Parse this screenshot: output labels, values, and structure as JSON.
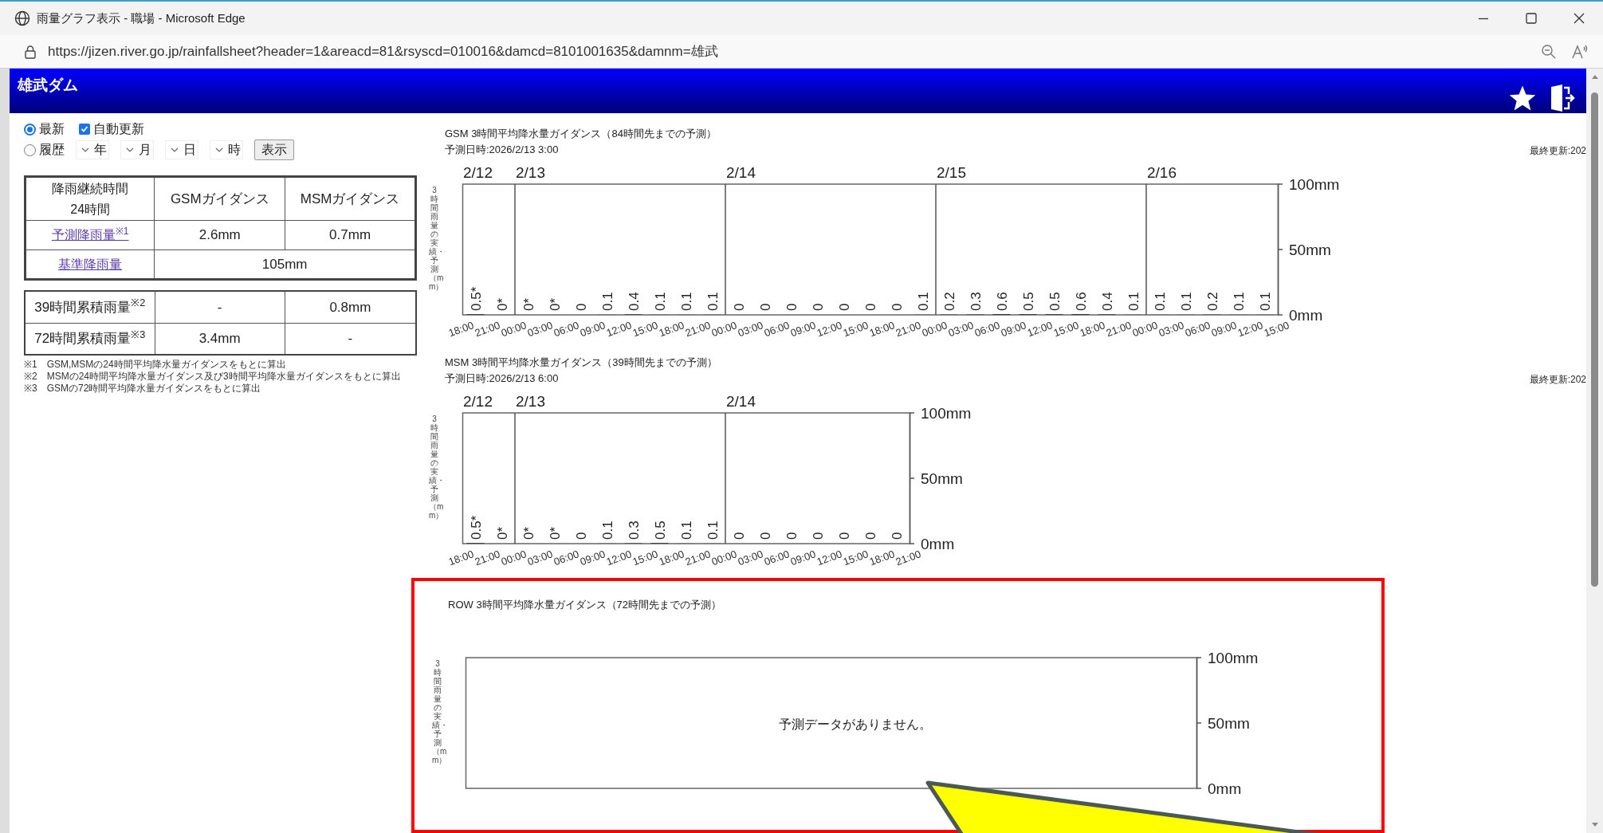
{
  "window": {
    "title": "雨量グラフ表示 - 職場 - Microsoft Edge"
  },
  "address_bar": {
    "url": "https://jizen.river.go.jp/rainfallsheet?header=1&areacd=81&rsyscd=010016&damcd=8101001635&damnm=雄武"
  },
  "header": {
    "title": "雄武ダム"
  },
  "mode_options": [
    {
      "label": "最新",
      "selected": true
    },
    {
      "label": "履歴",
      "selected": false
    }
  ],
  "auto_update": {
    "label": "自動更新",
    "checked": true
  },
  "date_selects": [
    "年",
    "月",
    "日",
    "時"
  ],
  "show_button": "表示",
  "rainfall_table": {
    "header": [
      "降雨継続時間\n24時間",
      "GSMガイダンス",
      "MSMガイダンス"
    ],
    "rows": [
      {
        "label": "予測降雨量$^{※1}$",
        "link": true,
        "cells": [
          "2.6mm",
          "0.7mm"
        ]
      },
      {
        "label": "基準降雨量",
        "link": true,
        "cells": [
          {
            "text": "105mm",
            "colspan": 2
          }
        ]
      }
    ]
  },
  "accumulated_table": {
    "rows": [
      {
        "label": "39時間累積雨量$^{※2}$",
        "link": false,
        "cells": [
          "-",
          "0.8mm"
        ]
      },
      {
        "label": "72時間累積雨量$^{※3}$",
        "link": false,
        "cells": [
          "3.4mm",
          "-"
        ]
      }
    ]
  },
  "notes": [
    "※1　GSM,MSMの24時間平均降水量ガイダンスをもとに算出",
    "※2　MSMの24時間平均降水量ガイダンス及び3時間平均降水量ガイダンスをもとに算出",
    "※3　GSMの72時間平均降水量ガイダンスをもとに算出"
  ],
  "charts": [
    {
      "title": "GSM 3時間平均降水量ガイダンス（84時間先までの予測）",
      "forecast_time": "予測日時:2026/2/13 3:00",
      "last_updated": "最終更新:202",
      "highlighted": false,
      "chart_data": {
        "type": "bar",
        "ylabel": "3時間雨量の実績・予測（mm）",
        "ylim": [
          0,
          100
        ],
        "xlim": [
          "2026-02-12T18:00",
          "2026-02-16T15:00"
        ],
        "grid": true,
        "yticks": [
          {
            "value": 0,
            "label": "0mm"
          },
          {
            "value": 50,
            "label": "50mm"
          },
          {
            "value": 100,
            "label": "100mm"
          }
        ],
        "x": [
          "2026-02-12T19:30",
          "2026-02-12T22:30",
          "2026-02-13T01:30",
          "2026-02-13T04:30",
          "2026-02-13T07:30",
          "2026-02-13T10:30",
          "2026-02-13T13:30",
          "2026-02-13T16:30",
          "2026-02-13T19:30",
          "2026-02-13T22:30",
          "2026-02-14T01:30",
          "2026-02-14T04:30",
          "2026-02-14T07:30",
          "2026-02-14T10:30",
          "2026-02-14T13:30",
          "2026-02-14T16:30",
          "2026-02-14T19:30",
          "2026-02-14T22:30",
          "2026-02-15T01:30",
          "2026-02-15T04:30",
          "2026-02-15T07:30",
          "2026-02-15T10:30",
          "2026-02-15T13:30",
          "2026-02-15T16:30",
          "2026-02-15T19:30",
          "2026-02-15T22:30",
          "2026-02-16T01:30",
          "2026-02-16T04:30",
          "2026-02-16T07:30",
          "2026-02-16T10:30",
          "2026-02-16T13:30"
        ],
        "values": [
          0.5,
          0,
          0,
          0,
          0,
          0.1,
          0.4,
          0.1,
          0.1,
          0.1,
          0,
          0,
          0,
          0,
          0,
          0,
          0,
          0.1,
          0.2,
          0.3,
          0.6,
          0.5,
          0.5,
          0.6,
          0.4,
          0.1,
          0.1,
          0.1,
          0.2,
          0.1,
          0.1
        ],
        "value_labels": [
          "0.5*",
          "0*",
          "0*",
          "0*",
          "0",
          "0.1",
          "0.4",
          "0.1",
          "0.1",
          "0.1",
          "0",
          "0",
          "0",
          "0",
          "0",
          "0",
          "0",
          "0.1",
          "0.2",
          "0.3",
          "0.6",
          "0.5",
          "0.5",
          "0.6",
          "0.4",
          "0.1",
          "0.1",
          "0.1",
          "0.2",
          "0.1",
          "0.1"
        ],
        "xticks": [
          {
            "value": "2026-02-12T18:00",
            "label": "18:00"
          },
          {
            "value": "2026-02-12T21:00",
            "label": "21:00"
          },
          {
            "value": "2026-02-13T00:00",
            "label": "00:00"
          },
          {
            "value": "2026-02-13T03:00",
            "label": "03:00"
          },
          {
            "value": "2026-02-13T06:00",
            "label": "06:00"
          },
          {
            "value": "2026-02-13T09:00",
            "label": "09:00"
          },
          {
            "value": "2026-02-13T12:00",
            "label": "12:00"
          },
          {
            "value": "2026-02-13T15:00",
            "label": "15:00"
          },
          {
            "value": "2026-02-13T18:00",
            "label": "18:00"
          },
          {
            "value": "2026-02-13T21:00",
            "label": "21:00"
          },
          {
            "value": "2026-02-14T00:00",
            "label": "00:00"
          },
          {
            "value": "2026-02-14T03:00",
            "label": "03:00"
          },
          {
            "value": "2026-02-14T06:00",
            "label": "06:00"
          },
          {
            "value": "2026-02-14T09:00",
            "label": "09:00"
          },
          {
            "value": "2026-02-14T12:00",
            "label": "12:00"
          },
          {
            "value": "2026-02-14T15:00",
            "label": "15:00"
          },
          {
            "value": "2026-02-14T18:00",
            "label": "18:00"
          },
          {
            "value": "2026-02-14T21:00",
            "label": "21:00"
          },
          {
            "value": "2026-02-15T00:00",
            "label": "00:00"
          },
          {
            "value": "2026-02-15T03:00",
            "label": "03:00"
          },
          {
            "value": "2026-02-15T06:00",
            "label": "06:00"
          },
          {
            "value": "2026-02-15T09:00",
            "label": "09:00"
          },
          {
            "value": "2026-02-15T12:00",
            "label": "12:00"
          },
          {
            "value": "2026-02-15T15:00",
            "label": "15:00"
          },
          {
            "value": "2026-02-15T18:00",
            "label": "18:00"
          },
          {
            "value": "2026-02-15T21:00",
            "label": "21:00"
          },
          {
            "value": "2026-02-16T00:00",
            "label": "00:00"
          },
          {
            "value": "2026-02-16T03:00",
            "label": "03:00"
          },
          {
            "value": "2026-02-16T06:00",
            "label": "06:00"
          },
          {
            "value": "2026-02-16T09:00",
            "label": "09:00"
          },
          {
            "value": "2026-02-16T12:00",
            "label": "12:00"
          },
          {
            "value": "2026-02-16T15:00",
            "label": "15:00"
          }
        ],
        "annotations": [
          "2/12",
          "2/13",
          "2/14",
          "2/15",
          "2/16"
        ]
      }
    },
    {
      "title": "MSM 3時間平均降水量ガイダンス（39時間先までの予測）",
      "forecast_time": "予測日時:2026/2/13 6:00",
      "last_updated": "最終更新:202",
      "highlighted": false,
      "chart_data": {
        "type": "bar",
        "ylabel": "3時間雨量の実績・予測（mm）",
        "ylim": [
          0,
          100
        ],
        "xlim": [
          "2026-02-12T18:00",
          "2026-02-14T21:00"
        ],
        "grid": true,
        "yticks": [
          {
            "value": 0,
            "label": "0mm"
          },
          {
            "value": 50,
            "label": "50mm"
          },
          {
            "value": 100,
            "label": "100mm"
          }
        ],
        "x": [
          "2026-02-12T19:30",
          "2026-02-12T22:30",
          "2026-02-13T01:30",
          "2026-02-13T04:30",
          "2026-02-13T07:30",
          "2026-02-13T10:30",
          "2026-02-13T13:30",
          "2026-02-13T16:30",
          "2026-02-13T19:30",
          "2026-02-13T22:30",
          "2026-02-14T01:30",
          "2026-02-14T04:30",
          "2026-02-14T07:30",
          "2026-02-14T10:30",
          "2026-02-14T13:30",
          "2026-02-14T16:30",
          "2026-02-14T19:30"
        ],
        "values": [
          0.5,
          0,
          0,
          0,
          0,
          0.1,
          0.3,
          0.5,
          0.1,
          0.1,
          0,
          0,
          0,
          0,
          0,
          0,
          0
        ],
        "value_labels": [
          "0.5*",
          "0*",
          "0*",
          "0*",
          "0",
          "0.1",
          "0.3",
          "0.5",
          "0.1",
          "0.1",
          "0",
          "0",
          "0",
          "0",
          "0",
          "0",
          "0"
        ],
        "xticks": [
          {
            "value": "2026-02-12T18:00",
            "label": "18:00"
          },
          {
            "value": "2026-02-12T21:00",
            "label": "21:00"
          },
          {
            "value": "2026-02-13T00:00",
            "label": "00:00"
          },
          {
            "value": "2026-02-13T03:00",
            "label": "03:00"
          },
          {
            "value": "2026-02-13T06:00",
            "label": "06:00"
          },
          {
            "value": "2026-02-13T09:00",
            "label": "09:00"
          },
          {
            "value": "2026-02-13T12:00",
            "label": "12:00"
          },
          {
            "value": "2026-02-13T15:00",
            "label": "15:00"
          },
          {
            "value": "2026-02-13T18:00",
            "label": "18:00"
          },
          {
            "value": "2026-02-13T21:00",
            "label": "21:00"
          },
          {
            "value": "2026-02-14T00:00",
            "label": "00:00"
          },
          {
            "value": "2026-02-14T03:00",
            "label": "03:00"
          },
          {
            "value": "2026-02-14T06:00",
            "label": "06:00"
          },
          {
            "value": "2026-02-14T09:00",
            "label": "09:00"
          },
          {
            "value": "2026-02-14T12:00",
            "label": "12:00"
          },
          {
            "value": "2026-02-14T15:00",
            "label": "15:00"
          },
          {
            "value": "2026-02-14T18:00",
            "label": "18:00"
          },
          {
            "value": "2026-02-14T21:00",
            "label": "21:00"
          }
        ],
        "annotations": [
          "2/12",
          "2/13",
          "2/14"
        ]
      }
    },
    {
      "title": "ROW 3時間平均降水量ガイダンス（72時間先までの予測）",
      "message": "予測データがありません。",
      "highlighted": true,
      "ylabel": "3時間雨量の実績・予測（mm）",
      "axis_labels": [
        "100mm",
        "50mm",
        "0mm"
      ]
    }
  ],
  "overlay": {
    "kind": "callout"
  }
}
